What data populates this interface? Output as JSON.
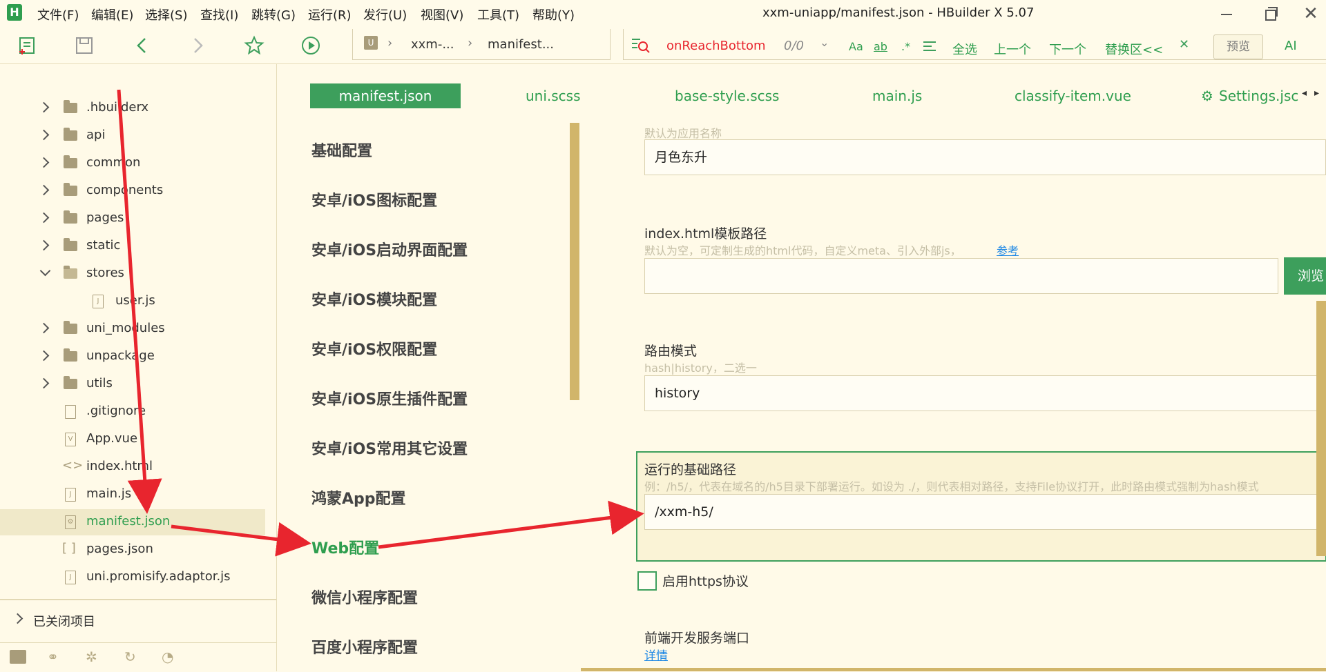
{
  "menu": [
    "文件(F)",
    "编辑(E)",
    "选择(S)",
    "查找(I)",
    "跳转(G)",
    "运行(R)",
    "发行(U)",
    "视图(V)",
    "工具(T)",
    "帮助(Y)"
  ],
  "title": "xxm-uniapp/manifest.json - HBuilder X 5.07",
  "breadcrumb": {
    "project": "xxm-...",
    "file": "manifest..."
  },
  "find": {
    "query": "onReachBottom",
    "count": "0/0",
    "case_label": "Aa",
    "word_label": "ab",
    "regex_label": ".*",
    "select_all": "全选",
    "prev": "上一个",
    "next": "下一个",
    "replace": "替换区<<"
  },
  "preview_label": "预览",
  "ai_label": "AI",
  "tree": [
    {
      "label": ".hbuilderx",
      "type": "folder"
    },
    {
      "label": "api",
      "type": "folder"
    },
    {
      "label": "common",
      "type": "folder"
    },
    {
      "label": "components",
      "type": "folder"
    },
    {
      "label": "pages",
      "type": "folder"
    },
    {
      "label": "static",
      "type": "folder"
    },
    {
      "label": "stores",
      "type": "folder-open"
    },
    {
      "label": "user.js",
      "type": "file-js"
    },
    {
      "label": "uni_modules",
      "type": "folder"
    },
    {
      "label": "unpackage",
      "type": "folder"
    },
    {
      "label": "utils",
      "type": "folder"
    },
    {
      "label": ".gitignore",
      "type": "file"
    },
    {
      "label": "App.vue",
      "type": "file-vue"
    },
    {
      "label": "index.html",
      "type": "file-html"
    },
    {
      "label": "main.js",
      "type": "file-js"
    },
    {
      "label": "manifest.json",
      "type": "file-json"
    },
    {
      "label": "pages.json",
      "type": "file-brackets"
    },
    {
      "label": "uni.promisify.adaptor.js",
      "type": "file-js"
    }
  ],
  "closed_projects": "已关闭项目",
  "tabs": [
    "manifest.json",
    "uni.scss",
    "base-style.scss",
    "main.js",
    "classify-item.vue",
    "Settings.jsc"
  ],
  "nav": [
    "基础配置",
    "安卓/iOS图标配置",
    "安卓/iOS启动界面配置",
    "安卓/iOS模块配置",
    "安卓/iOS权限配置",
    "安卓/iOS原生插件配置",
    "安卓/iOS常用其它设置",
    "鸿蒙App配置",
    "Web配置",
    "微信小程序配置",
    "百度小程序配置"
  ],
  "form": {
    "title_hint": "默认为应用名称",
    "title_value": "月色东升",
    "template_label": "index.html模板路径",
    "template_hint": "默认为空，可定制生成的html代码，自定义meta、引入外部js，",
    "template_link": "参考",
    "browse_label": "浏览",
    "router_label": "路由模式",
    "router_hint": "hash|history，二选一",
    "router_value": "history",
    "base_label": "运行的基础路径",
    "base_hint": "例：/h5/，代表在域名的/h5目录下部署运行。如设为 ./，则代表相对路径，支持File协议打开，此时路由模式强制为hash模式",
    "base_value": "/xxm-h5/",
    "https_label": "启用https协议",
    "port_label": "前端开发服务端口",
    "port_link": "详情"
  },
  "colors": {
    "accent": "#3d9f5c",
    "arrow": "#e8252e",
    "bg": "#fffae8"
  }
}
